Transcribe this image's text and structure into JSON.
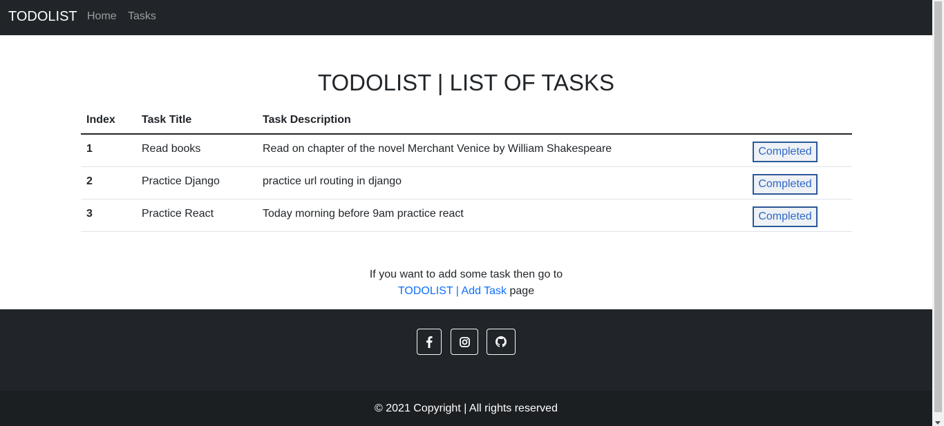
{
  "navbar": {
    "brand": "TODOLIST",
    "links": [
      {
        "label": "Home"
      },
      {
        "label": "Tasks"
      }
    ]
  },
  "heading": "TODOLIST | LIST OF TASKS",
  "table": {
    "headers": [
      "Index",
      "Task Title",
      "Task Description",
      ""
    ],
    "rows": [
      {
        "index": "1",
        "title": "Read books",
        "description": "Read on chapter of the novel Merchant Venice by William Shakespeare",
        "action": "Completed"
      },
      {
        "index": "2",
        "title": "Practice Django",
        "description": "practice url routing in django",
        "action": "Completed"
      },
      {
        "index": "3",
        "title": "Practice React",
        "description": "Today morning before 9am practice react",
        "action": "Completed"
      }
    ]
  },
  "note": {
    "line1": "If you want to add some task then go to",
    "link_brand": "TODOLIST",
    "separator": "|",
    "link_add": "Add Task",
    "suffix": "page"
  },
  "footer": {
    "social": [
      {
        "icon": "facebook-icon"
      },
      {
        "icon": "instagram-icon"
      },
      {
        "icon": "github-icon"
      }
    ],
    "copyright": "© 2021 Copyright | All rights reserved"
  },
  "colors": {
    "navbar_bg": "#212529",
    "link": "#0d6efd",
    "button_border": "#2b5797"
  }
}
